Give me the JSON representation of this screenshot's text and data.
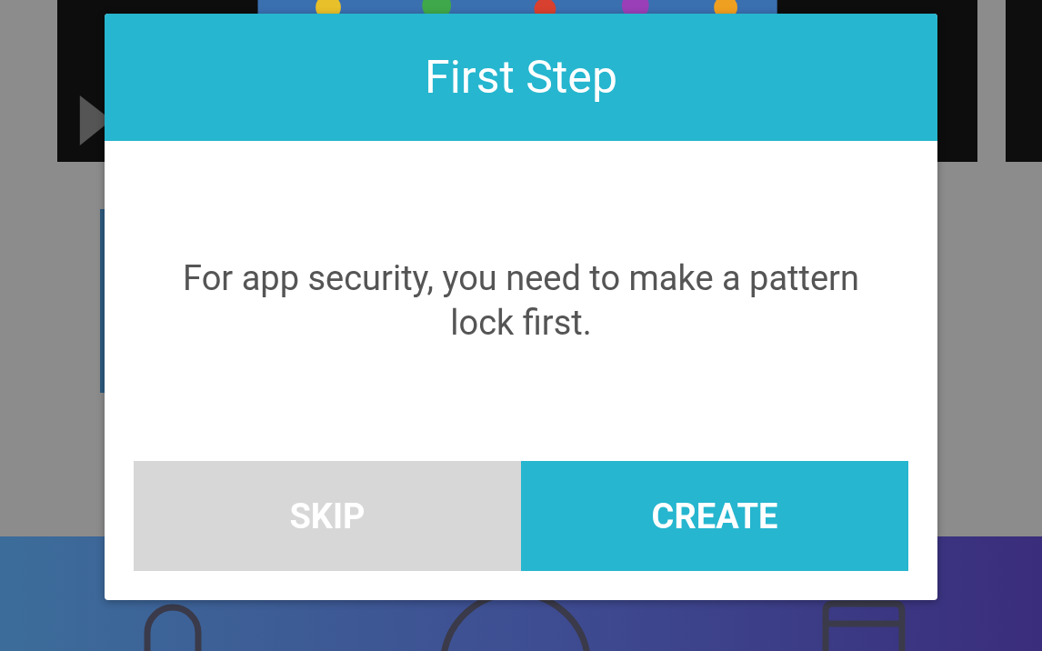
{
  "dialog": {
    "title": "First Step",
    "message": "For app security, you need to make a pattern lock first.",
    "buttons": [
      {
        "label": "SKIP",
        "kind": "secondary"
      },
      {
        "label": "CREATE",
        "kind": "primary"
      }
    ]
  }
}
